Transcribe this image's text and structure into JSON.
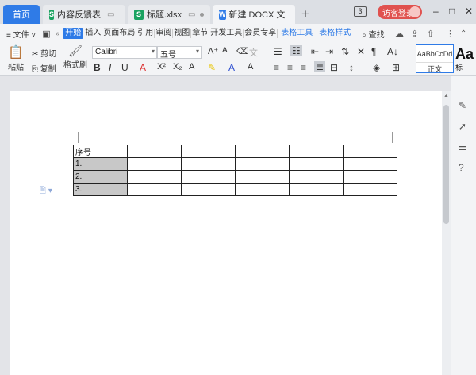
{
  "titlebar": {
    "tabs": [
      {
        "label": "首页"
      },
      {
        "label": "内容反馈表",
        "icon": "S"
      },
      {
        "label": "标题.xlsx",
        "icon": "S"
      },
      {
        "label": "新建 DOCX 文",
        "icon": "W"
      }
    ],
    "new_tab": "+",
    "window_count": "3",
    "login_label": "访客登录",
    "minimize": "–",
    "restore": "□",
    "close": "✕"
  },
  "menubar": {
    "file_label": "≡ 文件 ˅",
    "items": [
      "开始",
      "插入",
      "页面布局",
      "引用",
      "审阅",
      "视图",
      "章节",
      "开发工具",
      "会员专享"
    ],
    "table_tools": "表格工具",
    "table_style": "表格样式",
    "search_label": "查找"
  },
  "ribbon": {
    "paste_label": "粘贴",
    "cut_label": "剪切",
    "copy_label": "复制",
    "format_painter_label": "格式刷",
    "font_name": "Calibri",
    "font_size": "五号",
    "style_preview": "AaBbCcDd",
    "style_name": "正文",
    "style_preview2": "Aa",
    "style_name2": "标"
  },
  "document": {
    "table_rows": [
      [
        "序号",
        "",
        "",
        "",
        "",
        "",
        ""
      ],
      [
        "1.",
        "",
        "",
        "",
        "",
        "",
        ""
      ],
      [
        "2.",
        "",
        "",
        "",
        "",
        "",
        ""
      ],
      [
        "3.",
        "",
        "",
        "",
        "",
        "",
        ""
      ]
    ]
  },
  "colors": {
    "accent": "#2f7be7",
    "login": "#e0524f",
    "spreadsheet_icon": "#1aa260",
    "writer_icon": "#2f7be7"
  }
}
